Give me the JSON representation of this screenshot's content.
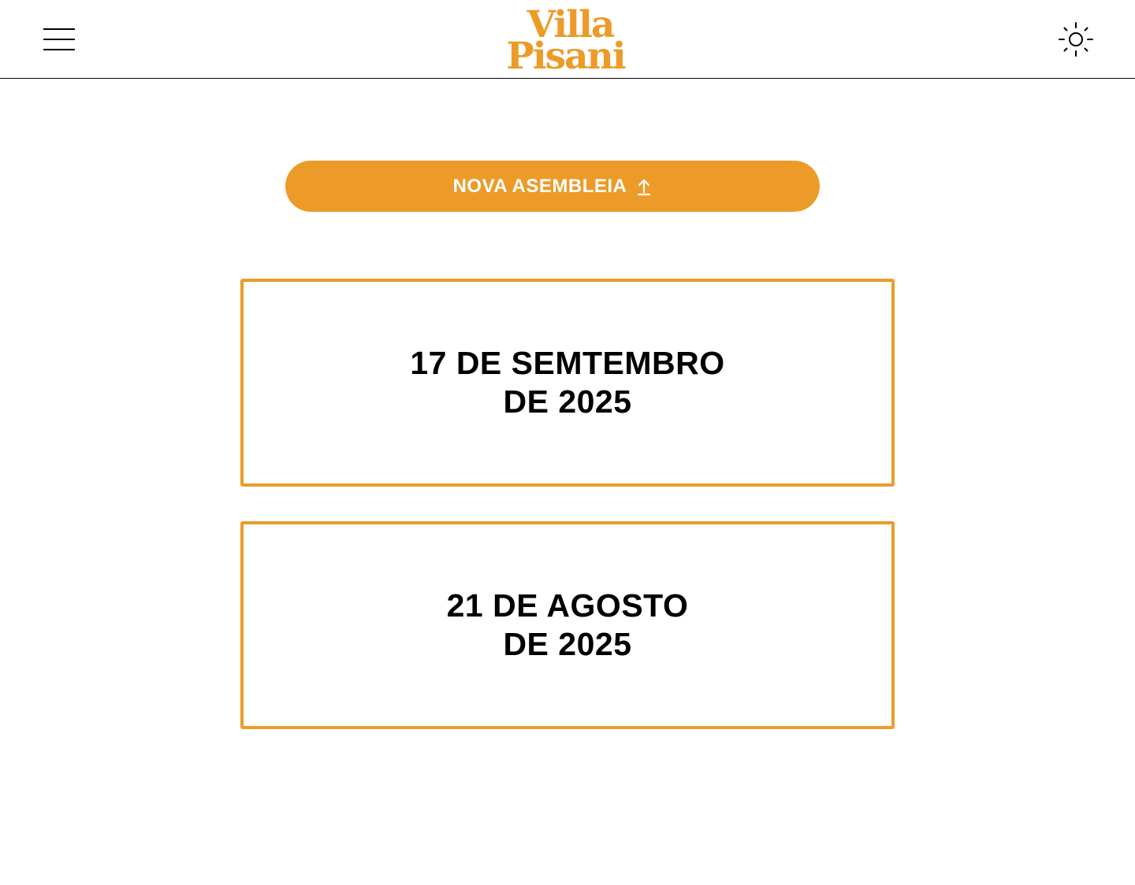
{
  "header": {
    "logo": {
      "line1": "Villa",
      "line2": "Pisani"
    },
    "menu_icon": "hamburger-icon",
    "theme_icon": "sun-icon"
  },
  "actions": {
    "new_assembly_label": "NOVA ASEMBLEIA",
    "new_assembly_icon": "upload-arrow-icon"
  },
  "assemblies": [
    {
      "line1": "17 DE SEMTEMBRO",
      "line2": "DE 2025"
    },
    {
      "line1": "21 DE AGOSTO",
      "line2": "DE 2025"
    }
  ],
  "colors": {
    "accent": "#ec9b29",
    "text": "#000000",
    "background": "#ffffff"
  }
}
